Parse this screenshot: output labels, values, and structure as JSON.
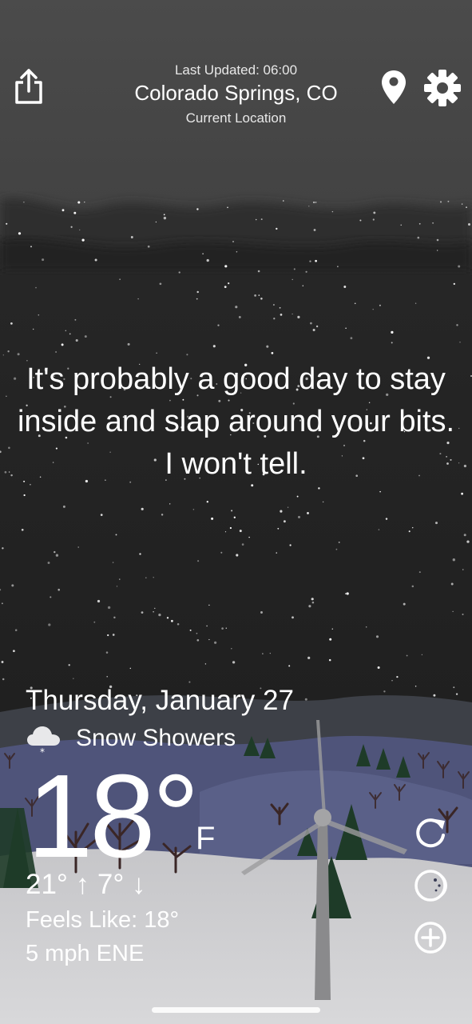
{
  "header": {
    "last_updated": "Last Updated: 06:00",
    "location_name": "Colorado Springs, CO",
    "location_sub": "Current Location",
    "share_icon": "share-icon",
    "pin_icon": "map-pin-icon",
    "settings_icon": "gear-icon"
  },
  "message": "It's probably a good day to stay inside and slap around your bits. I won't tell.",
  "weather": {
    "date": "Thursday, January 27",
    "condition": "Snow Showers",
    "condition_icon": "snow-cloud-icon",
    "temperature": "18°",
    "unit": "F",
    "hilo": "21° ↑  7° ↓",
    "feels_like": "Feels Like: 18°",
    "wind": "5 mph ENE"
  },
  "actions": {
    "refresh_icon": "refresh-icon",
    "theme_icon": "theme-toggle-icon",
    "add_icon": "add-location-icon"
  },
  "colors": {
    "sky_top": "#4a4a4a",
    "sky_dark": "#1f1f1f",
    "hill_blue": "#52577a",
    "snow_ground": "#d2d2d4",
    "tree_green": "#1f3f2a"
  }
}
